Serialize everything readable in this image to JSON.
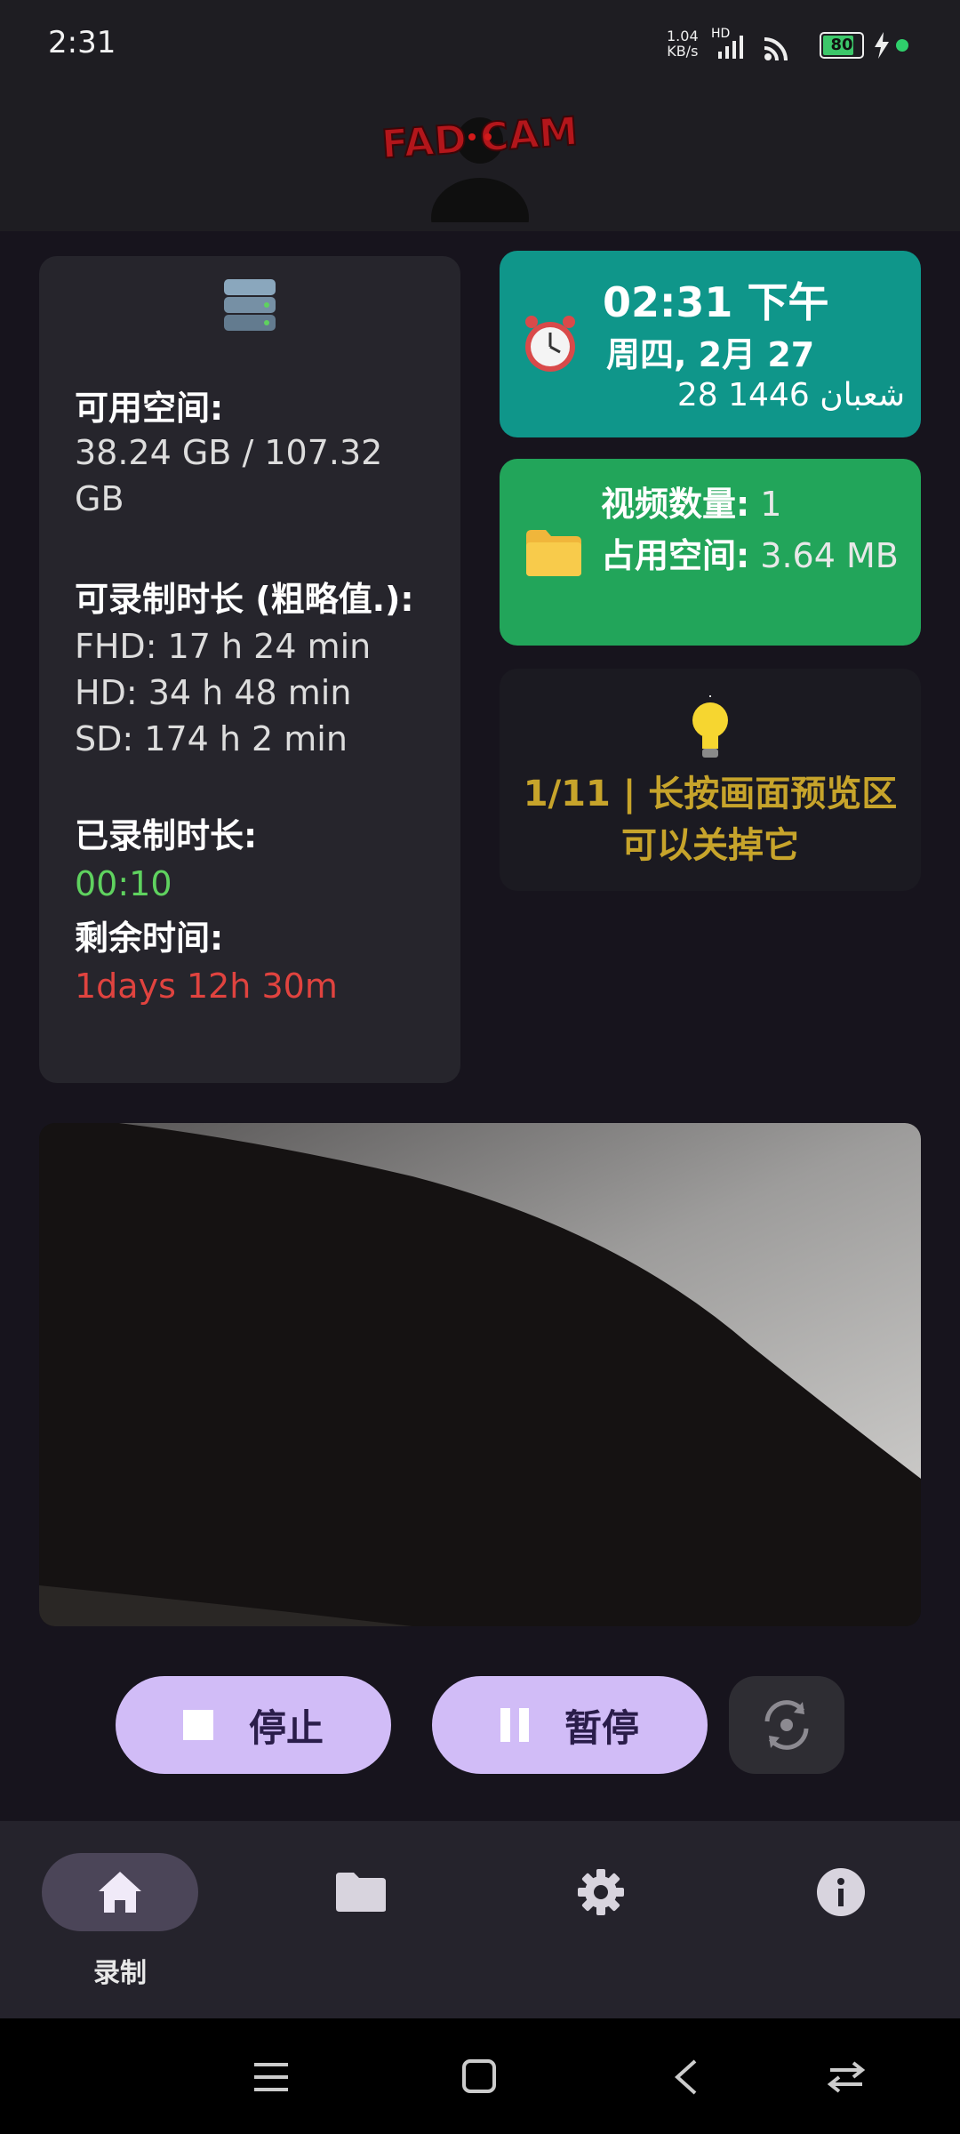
{
  "status_bar": {
    "time": "2:31",
    "net_speed_value": "1.04",
    "net_speed_unit": "KB/s",
    "network_type": "HD",
    "battery": "80"
  },
  "header": {
    "logo_text": "FADCAM"
  },
  "storage": {
    "available_label": "可用空间:",
    "available_value": "38.24 GB / 107.32 GB",
    "record_time_label": "可录制时长 (粗略值.):",
    "fhd": "FHD: 17 h 24 min",
    "hd": "HD: 34 h 48 min",
    "sd": "SD: 174 h 2 min",
    "recorded_label": "已录制时长:",
    "recorded_value": "00:10",
    "remaining_label": "剩余时间:",
    "remaining_value": "1days 12h 30m"
  },
  "clock": {
    "time": "02:31 下午",
    "date": "周四, 2月 27",
    "hijri": "28 شعبان 1446"
  },
  "videos": {
    "count_label": "视频数量:",
    "count_value": " 1",
    "size_label": "占用空间:",
    "size_value": " 3.64 MB"
  },
  "tip": {
    "text": "1/11 | 长按画面预览区可以关掉它"
  },
  "controls": {
    "stop_label": "停止",
    "pause_label": "暂停"
  },
  "bottom_nav": {
    "home_label": "录制"
  },
  "colors": {
    "clock_card": "#0f968a",
    "video_card": "#22a55a",
    "recorded_green": "#5fd25f",
    "remaining_red": "#e0433f",
    "tip_yellow": "#c7a42b",
    "pill": "#d1bcf7"
  }
}
